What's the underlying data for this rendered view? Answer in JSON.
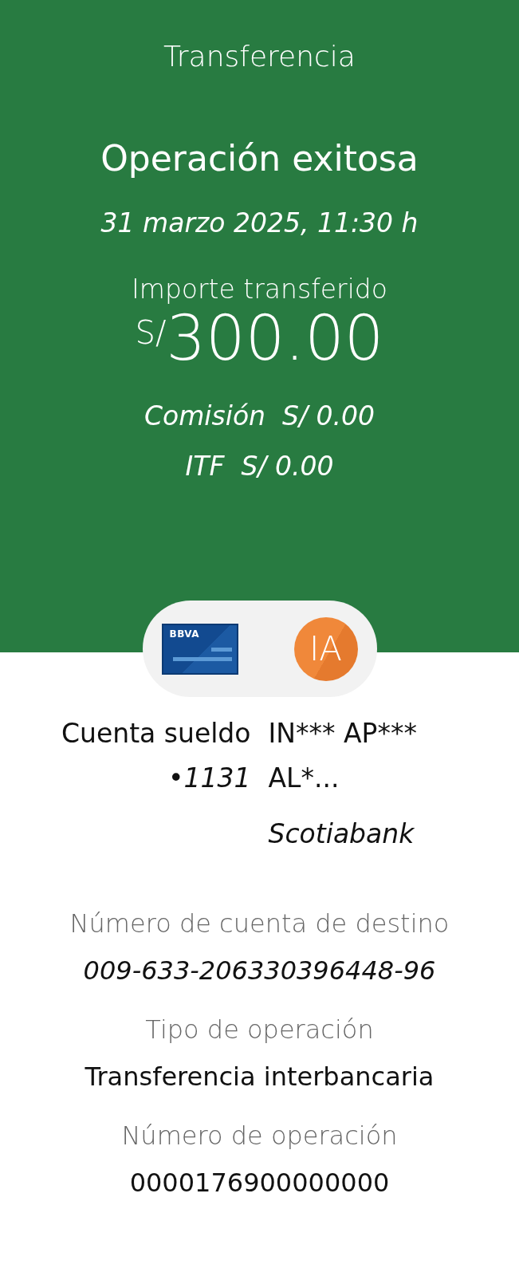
{
  "header": {
    "title": "Transferencia",
    "status": "Operación exitosa",
    "datetime": "31 marzo 2025, 11:30 h",
    "amount_label": "Importe transferido",
    "currency": "S/",
    "amount": "300.00",
    "fees": [
      "Comisión  S/ 0.00",
      "ITF  S/ 0.00"
    ]
  },
  "parties": {
    "origin_logo": "BBVA",
    "destination_initials": "IA"
  },
  "origin": {
    "account": "Cuenta sueldo",
    "number": "•1131"
  },
  "destination": {
    "name_line_1": "IN*** AP***",
    "name_line_2": "AL*...",
    "bank": "Scotiabank"
  },
  "details": [
    {
      "label": "Número de cuenta de destino",
      "value": "009-633-206330396448-96",
      "italic": true
    },
    {
      "label": "Tipo de operación",
      "value": "Transferencia interbancaria",
      "italic": false
    },
    {
      "label": "Número de operación",
      "value": "0000176900000000",
      "italic": false
    }
  ]
}
